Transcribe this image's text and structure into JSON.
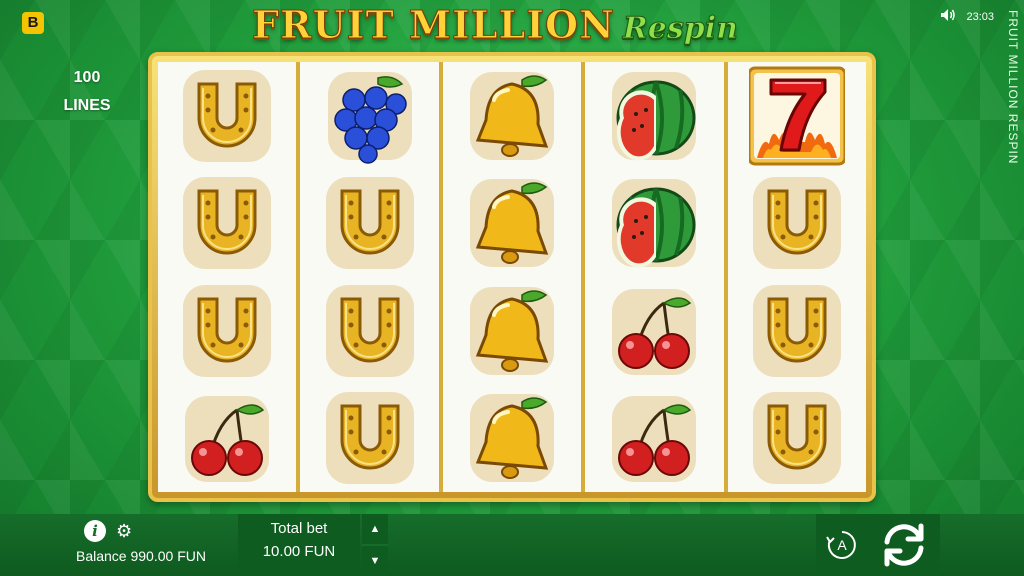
{
  "header": {
    "brand_logo": "B",
    "title_main": "FRUIT MILLION",
    "title_sub": "Respin",
    "lines_count": "100",
    "lines_label": "LINES",
    "time": "23:03",
    "vertical_title": "FRUIT MILLION RESPIN",
    "sound_icon": "speaker-icon"
  },
  "reels": [
    [
      "horseshoe",
      "horseshoe",
      "horseshoe",
      "cherry"
    ],
    [
      "grapes",
      "horseshoe",
      "horseshoe",
      "horseshoe"
    ],
    [
      "bell",
      "bell",
      "bell",
      "bell"
    ],
    [
      "watermelon",
      "watermelon",
      "cherry",
      "cherry"
    ],
    [
      "seven",
      "horseshoe",
      "horseshoe",
      "horseshoe"
    ]
  ],
  "footer": {
    "info_icon": "info-icon",
    "settings_icon": "gear-icon",
    "balance_label": "Balance",
    "balance_value": "990.00 FUN",
    "total_bet_label": "Total bet",
    "total_bet_value": "10.00 FUN",
    "bet_up_icon": "arrow-up-icon",
    "bet_down_icon": "arrow-down-icon",
    "autoplay_label": "A",
    "spin_icon": "spin-arrows-icon"
  },
  "colors": {
    "background_green": "#1f9a3a",
    "frame_gold": "#e9c24a",
    "title_gold": "#ffd23a",
    "title_green": "#8fe04a",
    "bar_green": "#0e5c1f"
  }
}
